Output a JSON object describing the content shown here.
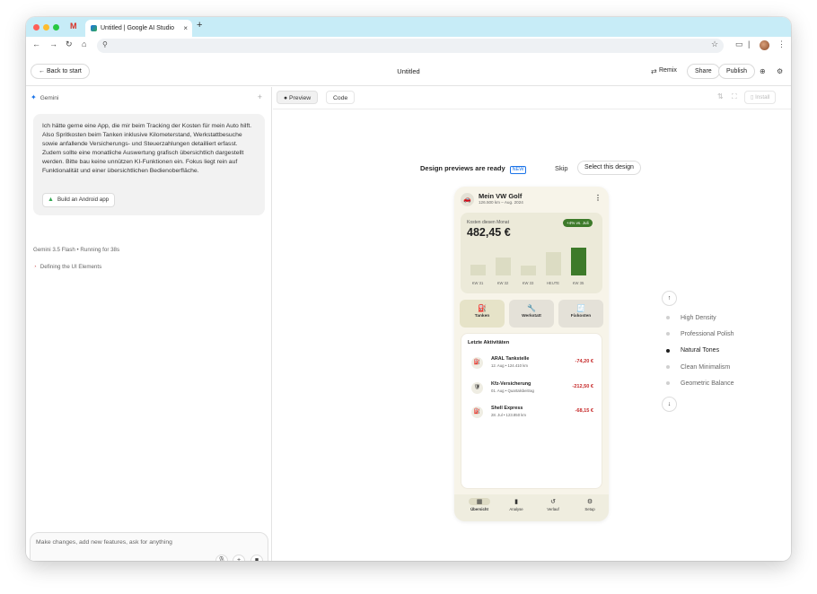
{
  "browser": {
    "tab_title": "Untitled | Google AI Studio",
    "tab_close": "×",
    "new_tab": "+"
  },
  "app": {
    "back_label": "Back to start",
    "title": "Untitled",
    "remix_label": "Remix",
    "share_label": "Share",
    "publish_label": "Publish"
  },
  "chat": {
    "agent_label": "Gemini",
    "user_message": "Ich hätte gerne eine App, die mir beim Tracking der Kosten für mein Auto hilft. Also Spritkosten beim Tanken inklusive Kilometerstand, Werkstattbesuche sowie anfallende Versicherungs- und Steuerzahlungen detailliert erfasst. Zudem sollte eine monatliche Auswertung grafisch übersichtlich dargestellt werden. Bitte bau keine unnützen KI-Funktionen ein. Fokus liegt rein auf Funktionalität und einer übersichtlichen Bedienoberfläche.",
    "chip_label": "Build an Android app",
    "model_label": "Gemini 3.5 Flash",
    "running_label": "Running for 38s",
    "step_label": "Defining the UI Elements",
    "input_placeholder": "Make changes, add new features, ask for anything"
  },
  "preview": {
    "tab_preview": "Preview",
    "tab_code": "Code",
    "install_label": "Install",
    "ready_label": "Design previews are ready",
    "new_badge": "NEW",
    "skip_label": "Skip",
    "select_label": "Select this design"
  },
  "phone": {
    "car_name": "Mein VW Golf",
    "car_sub": "126.500 km – Aug. 2024",
    "cost_label": "Kosten diesen Monat",
    "cost_value": "482,45 €",
    "cost_badge": "+4% vs. Juli",
    "chart_data": {
      "type": "bar",
      "categories": [
        "KW 31",
        "KW 32",
        "KW 33",
        "HEUTE",
        "KW 35"
      ],
      "values": [
        12,
        20,
        11,
        27,
        32
      ],
      "ylim": [
        0,
        40
      ],
      "highlight_index": 4,
      "colors": {
        "normal": "#dcdcc3",
        "highlight": "#3d7a2a"
      }
    },
    "actions": [
      {
        "label": "Tanken",
        "icon": "fuel-icon",
        "glyph": "⛽"
      },
      {
        "label": "Werkstatt",
        "icon": "wrench-icon",
        "glyph": "🔧"
      },
      {
        "label": "Fixkosten",
        "icon": "receipt-icon",
        "glyph": "🧾"
      }
    ],
    "activities_title": "Letzte Aktivitäten",
    "activities": [
      {
        "name": "ARAL Tankstelle",
        "sub": "12. Aug • 124.410 km",
        "amount": "-74,20 €",
        "glyph": "⛽"
      },
      {
        "name": "Kfz-Versicherung",
        "sub": "01. Aug • Quartalsbeitrag",
        "amount": "-212,50 €",
        "glyph": "🛡"
      },
      {
        "name": "Shell Express",
        "sub": "28. Jul • 123.850 km",
        "amount": "-68,15 €",
        "glyph": "⛽"
      }
    ],
    "nav": [
      {
        "label": "Übersicht",
        "glyph": "▦"
      },
      {
        "label": "Analyse",
        "glyph": "▮"
      },
      {
        "label": "Verlauf",
        "glyph": "↺"
      },
      {
        "label": "Setup",
        "glyph": "⚙"
      }
    ]
  },
  "styles": {
    "items": [
      "High Density",
      "Professional Polish",
      "Natural Tones",
      "Clean Minimalism",
      "Geometric Balance"
    ],
    "active_index": 2
  }
}
